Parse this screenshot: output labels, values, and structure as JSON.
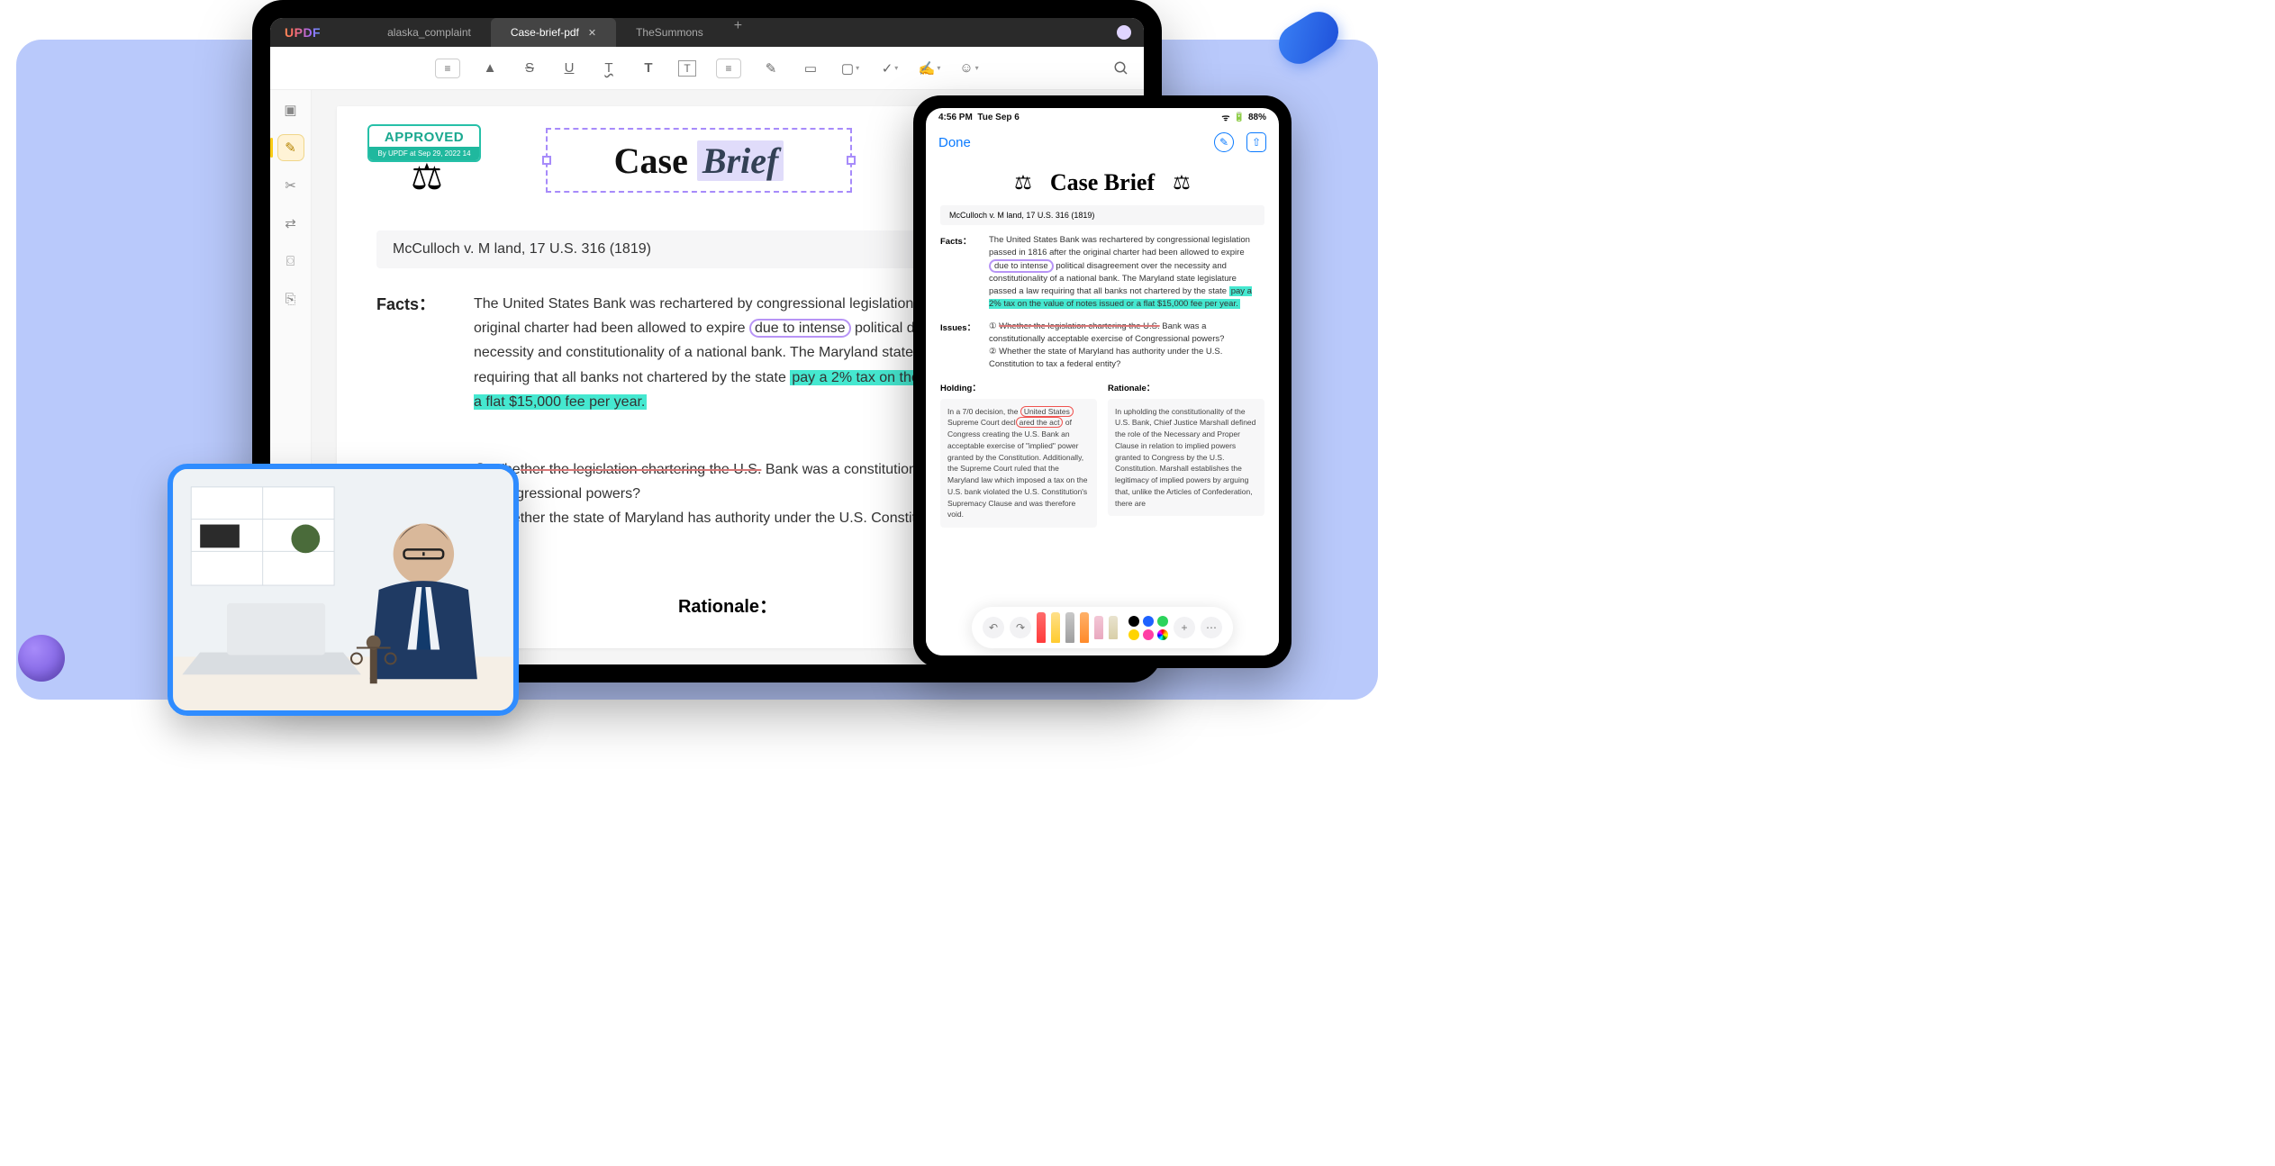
{
  "app": {
    "logo": "UPDF"
  },
  "tabs": [
    {
      "label": "alaska_complaint",
      "active": false
    },
    {
      "label": "Case-brief-pdf",
      "active": true
    },
    {
      "label": "TheSummons",
      "active": false
    }
  ],
  "stamp": {
    "label": "APPROVED",
    "meta": "By UPDF at Sep 29, 2022   14"
  },
  "title": {
    "word1": "Case",
    "word2": "Brief"
  },
  "citation": "McCulloch v. M land, 17 U.S. 316 (1819)",
  "facts": {
    "label": "Facts：",
    "pre": "The United States Bank was rechartered by congressional legislation passed in 1816 after the original charter had been allowed to expire ",
    "circled": "due to intense",
    "mid": " political disagreement over the necessity and constitutionality of a national bank. The Maryland state legislature passed a law requiring that all banks not chartered by the state ",
    "hl": "pay a 2% tax on the value of notes issued or a flat $15,000 fee per year."
  },
  "issues": {
    "pre1": "① Whe",
    "strike": "ther the legislation chartering the U.S.",
    "post1": " Bank was a constitutionally acceptable exercise of Congressional powers?",
    "line2": "② Whether the state of Maryland has authority under the U.S. Constitution to tax a federal entity?"
  },
  "rationale_label": "Rationale：",
  "tablet": {
    "time": "4:56 PM",
    "date": "Tue Sep 6",
    "battery": "88%",
    "done": "Done",
    "title": "Case Brief",
    "citation": "McCulloch v. M land, 17 U.S. 316 (1819)",
    "facts_label": "Facts：",
    "facts_pre": "The United States Bank was rechartered by congressional legislation passed in 1816 after the original charter had been allowed to expire ",
    "facts_circ": "due to intense",
    "facts_mid": " political disagreement over the necessity and constitutionality of a national bank. The Maryland state legislature passed a law requiring that all banks not chartered by the state ",
    "facts_hl": "pay a 2% tax on the value of notes issued or a flat $15,000 fee per year.",
    "issues_label": "Issues：",
    "issues_1a": "① ",
    "issues_1s": "Whether the legislation chartering the U.S.",
    "issues_1b": " Bank was a constitutionally acceptable exercise of Congressional powers?",
    "issues_2": "② Whether the state of Maryland has authority under the U.S. Constitution to tax a federal entity?",
    "holding_label": "Holding：",
    "holding_a": "In a 7/0 decision, the ",
    "holding_r1": "United States",
    "holding_b": " Supreme Court decl",
    "holding_r2": "ared the act",
    "holding_c": " of Congress creating the U.S. Bank an acceptable exercise of \"implied\" power granted by the Constitution. Additionally, the Supreme Court ruled that the Maryland law which imposed a tax on the U.S. bank violated the U.S. Constitution's Supremacy Clause and was therefore void.",
    "rationale_label": "Rationale：",
    "rationale_text": "In upholding the constitutionality of the U.S. Bank, Chief Justice Marshall defined the role of the Necessary and Proper Clause in relation to implied powers granted to Congress by the U.S. Constitution. Marshall establishes the legitimacy of implied powers by arguing that, unlike the Articles of Confederation, there are"
  },
  "colors": {
    "swatches_top": [
      "#000000",
      "#1e62ff",
      "#2bd35b"
    ],
    "swatches_bot": [
      "#ffd400",
      "#ff3ea5",
      "conic"
    ]
  }
}
